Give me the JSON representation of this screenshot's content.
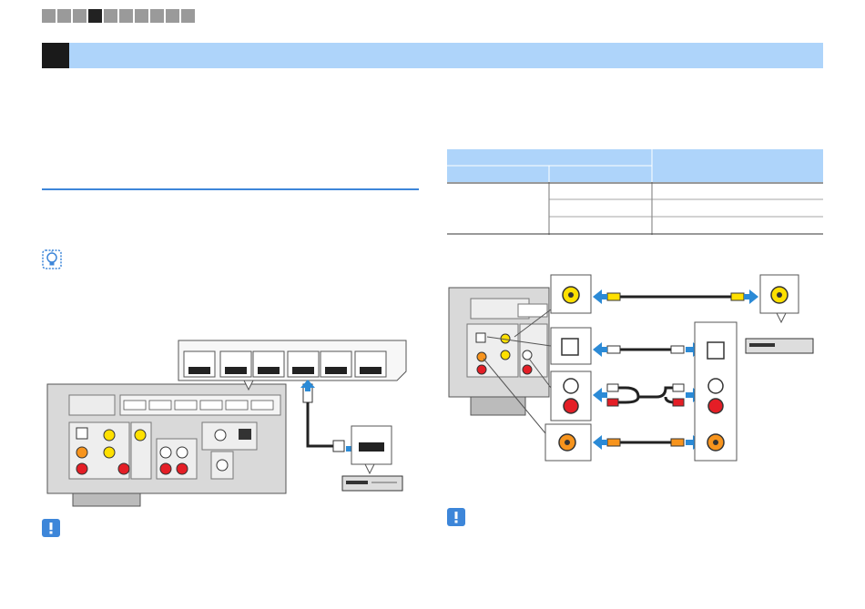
{
  "page": {
    "nav_segments": {
      "count": 10,
      "active_index": 3,
      "active_color": "#222222",
      "inactive_color": "#9a9a9a"
    },
    "header_band_color": "#aed4fa",
    "accent_color": "#3d86d9",
    "tip_icon": "light-bulb-icon",
    "note_icon": "exclamation-icon"
  }
}
